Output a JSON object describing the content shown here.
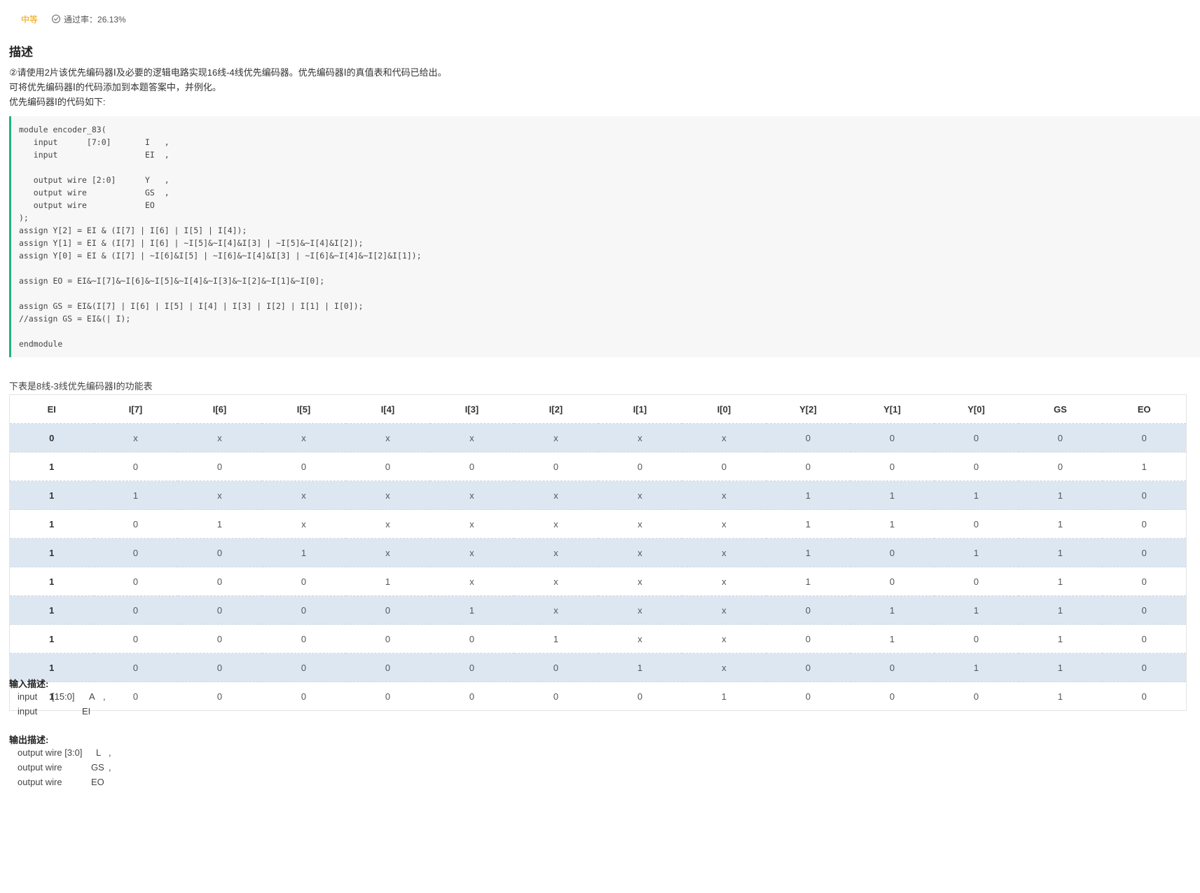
{
  "meta": {
    "difficulty": "中等",
    "pass_rate": "通过率：26.13%"
  },
  "description": {
    "heading": "描述",
    "lines": [
      "②请使用2片该优先编码器Ⅰ及必要的逻辑电路实现16线-4线优先编码器。优先编码器Ⅰ的真值表和代码已给出。",
      "可将优先编码器Ⅰ的代码添加到本题答案中，并例化。",
      "优先编码器Ⅰ的代码如下:"
    ]
  },
  "code": {
    "lines": [
      "module encoder_83(",
      "   input      [7:0]       I   ,",
      "   input                  EI  ,",
      "",
      "   output wire [2:0]      Y   ,",
      "   output wire            GS  ,",
      "   output wire            EO",
      ");",
      "assign Y[2] = EI & (I[7] | I[6] | I[5] | I[4]);",
      "assign Y[1] = EI & (I[7] | I[6] | ~I[5]&~I[4]&I[3] | ~I[5]&~I[4]&I[2]);",
      "assign Y[0] = EI & (I[7] | ~I[6]&I[5] | ~I[6]&~I[4]&I[3] | ~I[6]&~I[4]&~I[2]&I[1]);",
      "",
      "assign EO = EI&~I[7]&~I[6]&~I[5]&~I[4]&~I[3]&~I[2]&~I[1]&~I[0];",
      "",
      "assign GS = EI&(I[7] | I[6] | I[5] | I[4] | I[3] | I[2] | I[1] | I[0]);",
      "//assign GS = EI&(| I);",
      "",
      "endmodule"
    ]
  },
  "table": {
    "caption": "下表是8线-3线优先编码器Ⅰ的功能表",
    "headers": [
      "EI",
      "I[7]",
      "I[6]",
      "I[5]",
      "I[4]",
      "I[3]",
      "I[2]",
      "I[1]",
      "I[0]",
      "Y[2]",
      "Y[1]",
      "Y[0]",
      "GS",
      "EO"
    ],
    "rows": [
      [
        "0",
        "x",
        "x",
        "x",
        "x",
        "x",
        "x",
        "x",
        "x",
        "0",
        "0",
        "0",
        "0",
        "0"
      ],
      [
        "1",
        "0",
        "0",
        "0",
        "0",
        "0",
        "0",
        "0",
        "0",
        "0",
        "0",
        "0",
        "0",
        "1"
      ],
      [
        "1",
        "1",
        "x",
        "x",
        "x",
        "x",
        "x",
        "x",
        "x",
        "1",
        "1",
        "1",
        "1",
        "0"
      ],
      [
        "1",
        "0",
        "1",
        "x",
        "x",
        "x",
        "x",
        "x",
        "x",
        "1",
        "1",
        "0",
        "1",
        "0"
      ],
      [
        "1",
        "0",
        "0",
        "1",
        "x",
        "x",
        "x",
        "x",
        "x",
        "1",
        "0",
        "1",
        "1",
        "0"
      ],
      [
        "1",
        "0",
        "0",
        "0",
        "1",
        "x",
        "x",
        "x",
        "x",
        "1",
        "0",
        "0",
        "1",
        "0"
      ],
      [
        "1",
        "0",
        "0",
        "0",
        "0",
        "1",
        "x",
        "x",
        "x",
        "0",
        "1",
        "1",
        "1",
        "0"
      ],
      [
        "1",
        "0",
        "0",
        "0",
        "0",
        "0",
        "1",
        "x",
        "x",
        "0",
        "1",
        "0",
        "1",
        "0"
      ],
      [
        "1",
        "0",
        "0",
        "0",
        "0",
        "0",
        "0",
        "1",
        "x",
        "0",
        "0",
        "1",
        "1",
        "0"
      ],
      [
        "1",
        "0",
        "0",
        "0",
        "0",
        "0",
        "0",
        "0",
        "1",
        "0",
        "0",
        "0",
        "1",
        "0"
      ]
    ]
  },
  "input_desc": {
    "heading": "输入描述:",
    "lines": [
      [
        "input",
        "[15:0]",
        "A",
        ","
      ],
      [
        "input",
        "",
        "EI",
        ""
      ]
    ]
  },
  "output_desc": {
    "heading": "输出描述:",
    "lines": [
      [
        "output wire [3:0]",
        "L",
        ","
      ],
      [
        "output wire",
        "GS",
        ","
      ],
      [
        "output wire",
        "EO",
        ""
      ]
    ]
  }
}
